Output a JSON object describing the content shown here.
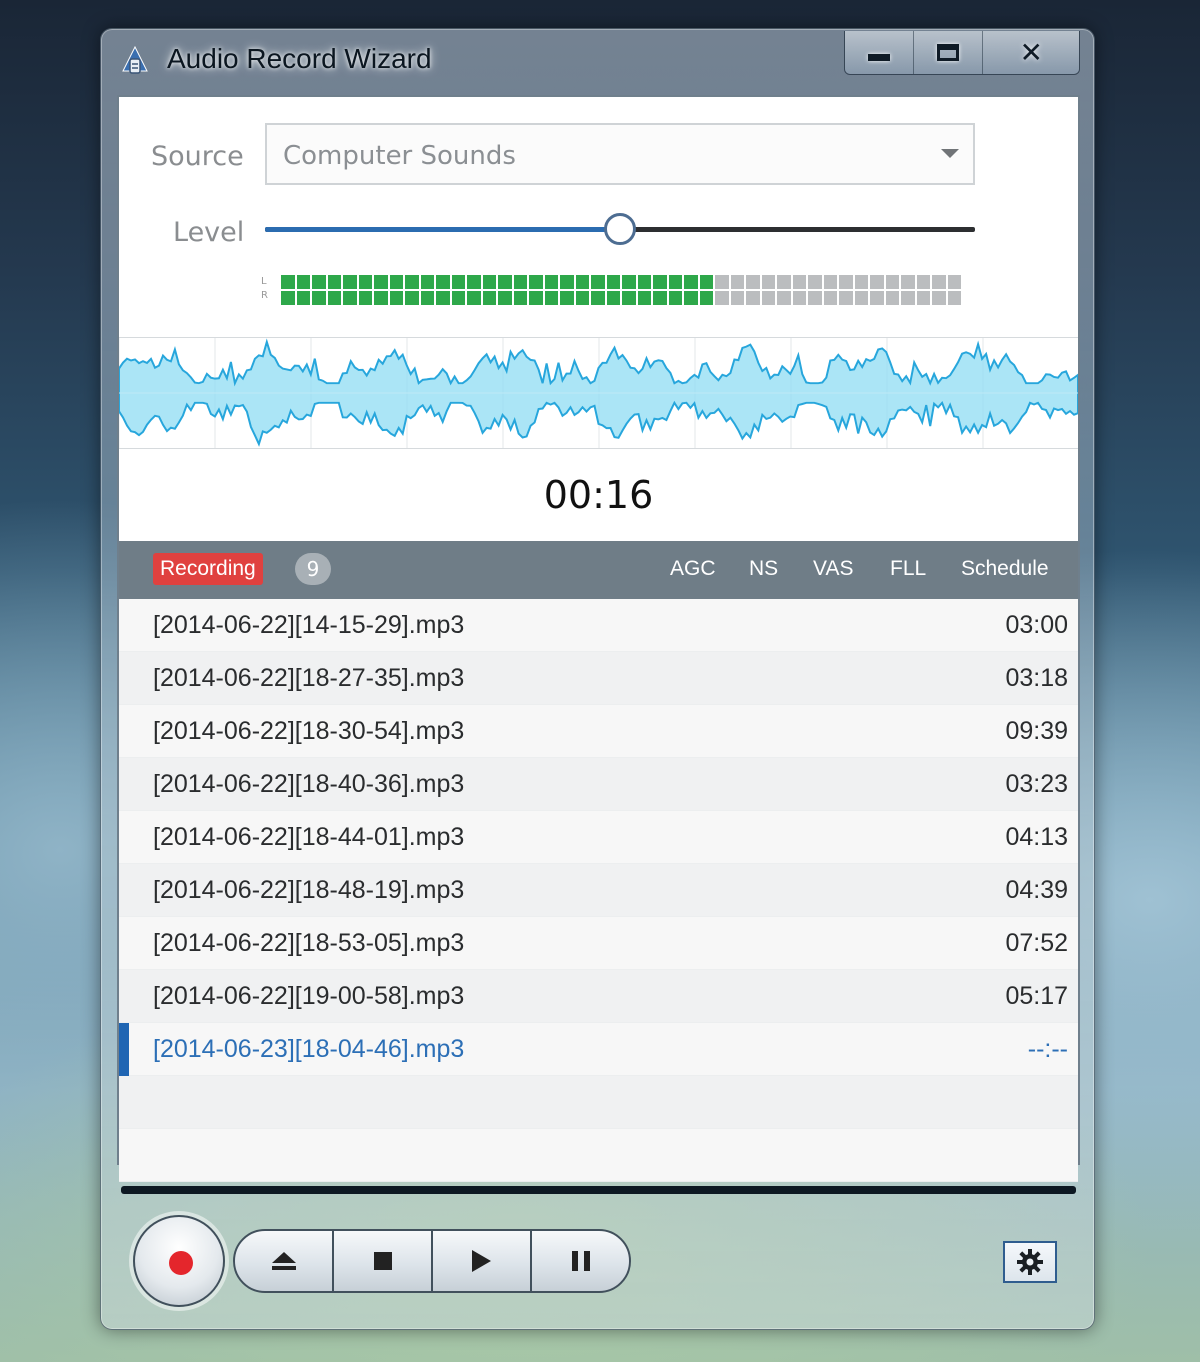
{
  "window": {
    "title": "Audio Record Wizard"
  },
  "source": {
    "label": "Source",
    "value": "Computer Sounds"
  },
  "level": {
    "label": "Level",
    "value_percent": 50
  },
  "meter": {
    "channel_labels": [
      "L",
      "R"
    ],
    "segments_total": 44,
    "segments_lit": 28
  },
  "timer": "00:16",
  "list_header": {
    "recording_label": "Recording",
    "count": "9",
    "columns": [
      "AGC",
      "NS",
      "VAS",
      "FLL",
      "Schedule"
    ]
  },
  "recordings": [
    {
      "name": "[2014-06-22][14-15-29].mp3",
      "duration": "03:00"
    },
    {
      "name": "[2014-06-22][18-27-35].mp3",
      "duration": "03:18"
    },
    {
      "name": "[2014-06-22][18-30-54].mp3",
      "duration": "09:39"
    },
    {
      "name": "[2014-06-22][18-40-36].mp3",
      "duration": "03:23"
    },
    {
      "name": "[2014-06-22][18-44-01].mp3",
      "duration": "04:13"
    },
    {
      "name": "[2014-06-22][18-48-19].mp3",
      "duration": "04:39"
    },
    {
      "name": "[2014-06-22][18-53-05].mp3",
      "duration": "07:52"
    },
    {
      "name": "[2014-06-22][19-00-58].mp3",
      "duration": "05:17"
    },
    {
      "name": "[2014-06-23][18-04-46].mp3",
      "duration": "--:--"
    }
  ],
  "active_recording_index": 8,
  "colors": {
    "accent": "#2b6cb0",
    "record_red": "#e4262c",
    "meter_green": "#2ea84a",
    "waveform_fill": "#8fdcf3",
    "waveform_stroke": "#27a6dc",
    "header_bg": "#6f7d87"
  },
  "icons": {
    "app": "audio-wizard-icon",
    "minimize": "minimize-icon",
    "maximize": "maximize-icon",
    "close": "close-icon",
    "dropdown": "chevron-down-icon",
    "record": "record-icon",
    "eject": "eject-icon",
    "stop": "stop-icon",
    "play": "play-icon",
    "pause": "pause-icon",
    "settings": "gear-icon"
  }
}
